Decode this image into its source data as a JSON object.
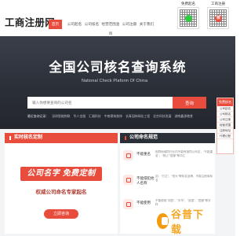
{
  "header": {
    "logo": "工商注册网",
    "nav": [
      "首页",
      "公司起名",
      "公司核名",
      "经营范围查询",
      "公司注册",
      "关于我们"
    ],
    "qr_left": {
      "title": "免费起名",
      "phone": ""
    },
    "qr_right": {
      "title": "工商注册",
      "badge": "核"
    }
  },
  "hero": {
    "title": "全国公司核名查询系统",
    "subtitle": "National Check Plaform Of China",
    "search_placeholder": "输入你想要查询的公司名",
    "search_button": "查询",
    "hot_label": "最近查询记录：",
    "hot_items": [
      "深圳智能物联",
      "华人金服",
      "汇福科技",
      "中南建筑装饰",
      "长青园林绿化工程",
      "北京科技发展",
      "湖南鑫源粮食"
    ]
  },
  "sidebar": {
    "head": "免费核名",
    "items": [
      "公司起名",
      "公司核名",
      "公司注册",
      "经营范围",
      "注册地址",
      "代理记账"
    ]
  },
  "left_card": {
    "title": "实时核名定制",
    "promo_title": "公司名字 免费定制",
    "promo_sub": "权威公司命名专家起名",
    "promo_button": "立即咨询"
  },
  "right_card": {
    "title": "公司命名规范",
    "rules": [
      {
        "title": "不能重名",
        "desc": "相同地域同行业内不能有相同公司名，“不能重名”，“禁止”“国家”等词汇"
      },
      {
        "title": "不能侵犯他人名称",
        "desc": "如：“万达”、“恒大”等知名品牌，不能注册商标名"
      },
      {
        "title": "不能使用",
        "desc": "不能使用“中国”、“中华”、“全国”、“国家”等字样"
      }
    ]
  },
  "watermark": {
    "text": "谷普下载"
  },
  "colors": {
    "accent": "#e74c3c",
    "dark": "#2b2f37",
    "hero_bg": "#2f333b"
  }
}
